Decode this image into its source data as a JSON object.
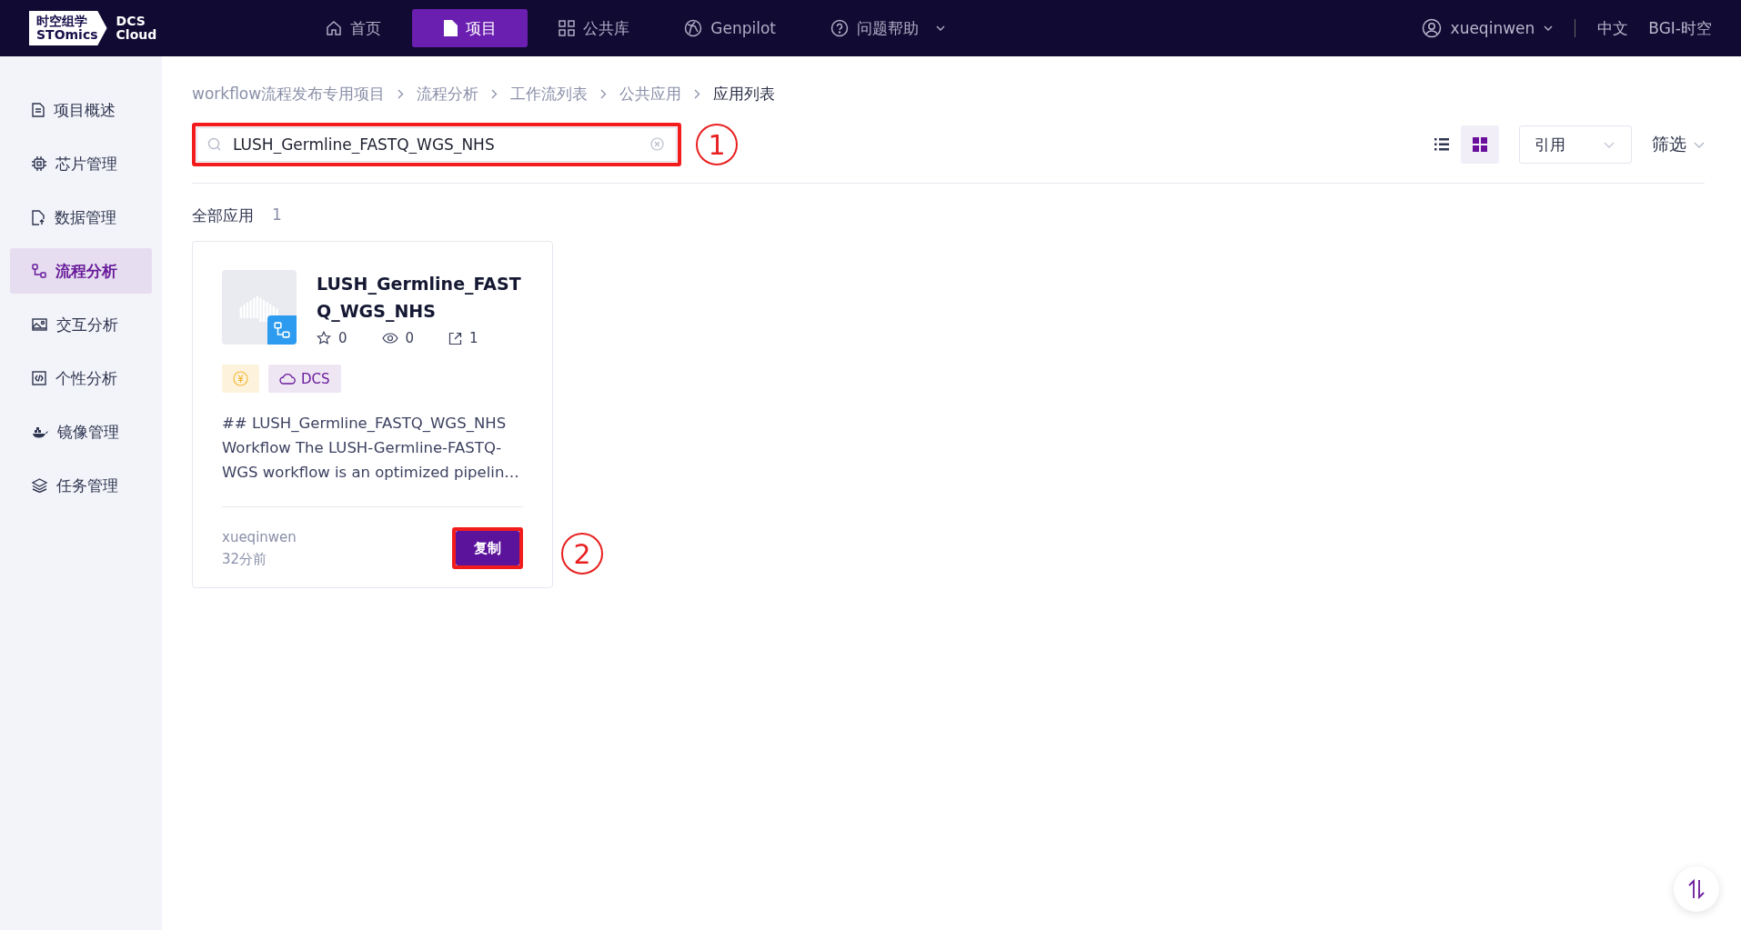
{
  "logo": {
    "cn": "时空组学",
    "en": "STOmics",
    "product_line1": "DCS",
    "product_line2": "Cloud"
  },
  "nav": [
    {
      "label": "首页",
      "selected": false
    },
    {
      "label": "项目",
      "selected": true
    },
    {
      "label": "公共库",
      "selected": false
    },
    {
      "label": "Genpilot",
      "selected": false
    },
    {
      "label": "问题帮助",
      "selected": false
    }
  ],
  "user": {
    "name": "xueqinwen"
  },
  "language": "中文",
  "org": "BGI-时空",
  "sidebar": {
    "items": [
      {
        "label": "项目概述",
        "selected": false
      },
      {
        "label": "芯片管理",
        "selected": false
      },
      {
        "label": "数据管理",
        "selected": false
      },
      {
        "label": "流程分析",
        "selected": true
      },
      {
        "label": "交互分析",
        "selected": false
      },
      {
        "label": "个性分析",
        "selected": false
      },
      {
        "label": "镜像管理",
        "selected": false
      },
      {
        "label": "任务管理",
        "selected": false
      }
    ]
  },
  "breadcrumb": [
    "workflow流程发布专用项目",
    "流程分析",
    "工作流列表",
    "公共应用",
    "应用列表"
  ],
  "search": {
    "value": "LUSH_Germline_FASTQ_WGS_NHS",
    "annotation": "1"
  },
  "view_toggle": [
    {
      "kind": "list",
      "selected": false
    },
    {
      "kind": "grid",
      "selected": true
    }
  ],
  "sort_select": {
    "value": "引用"
  },
  "filter": {
    "label": "筛选"
  },
  "summary": {
    "label": "全部应用",
    "count": "1"
  },
  "cards": [
    {
      "title": "LUSH_Germline_FASTQ_WGS_NHS",
      "stars": "0",
      "views": "0",
      "refs": "1",
      "tags": [
        {
          "kind": "price"
        },
        {
          "kind": "cloud",
          "label": "DCS"
        }
      ],
      "description": "## LUSH_Germline_FASTQ_WGS_NHS Workflow The LUSH-Germline-FASTQ-WGS workflow is an optimized pipelin…",
      "author": "xueqinwen",
      "time": "32分前",
      "button": "复制",
      "annotation": "2"
    }
  ]
}
